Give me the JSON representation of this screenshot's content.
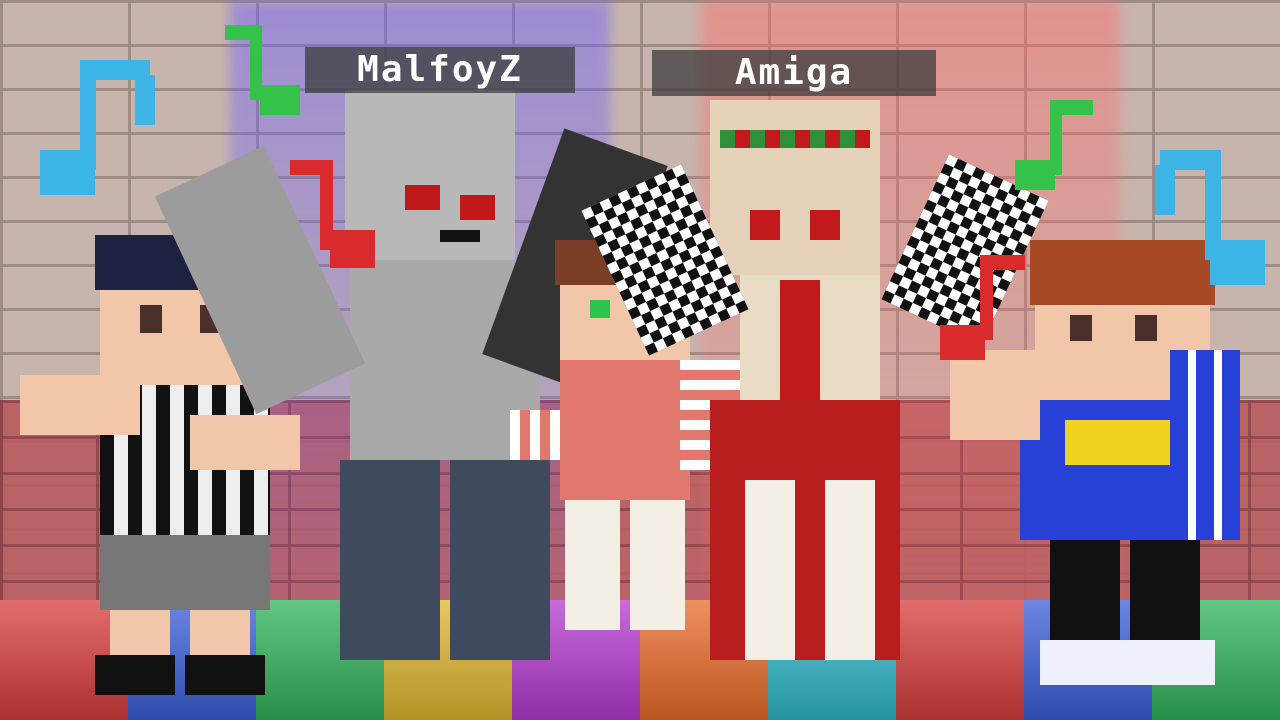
{
  "nametags": {
    "left": "MalfoyZ",
    "right": "Amiga"
  },
  "notes": {
    "colors": {
      "blue": "#3db4e6",
      "green": "#35c24a",
      "red": "#d92b2b"
    }
  },
  "scene_colors": {
    "wall": "#c7b5ad",
    "wall_lower": "#b85b5f",
    "light_left": "#6a5cff",
    "light_right": "#ff6a6a"
  }
}
